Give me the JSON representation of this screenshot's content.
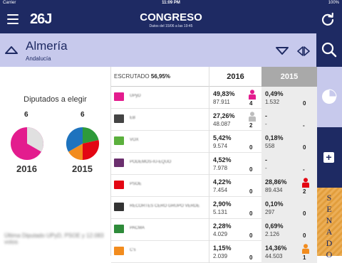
{
  "status": {
    "carrier": "Carrier",
    "time": "11:09 PM",
    "battery": "100%"
  },
  "nav": {
    "logo": "26J",
    "title": "CONGRESO",
    "subtitle": "Datos del 15/06 a las 19:45"
  },
  "region": {
    "name": "Almería",
    "sub": "Andalucía"
  },
  "left": {
    "title": "Diputados a elegir",
    "seats_2016": "6",
    "seats_2015": "6",
    "year_2016": "2016",
    "year_2015": "2015",
    "footer": "Última Diputado UPyD, PSOE y 12.083 votos"
  },
  "table": {
    "escrutado_label": "ESCRUTADO",
    "escrutado_value": "56,95%",
    "col_2016": "2016",
    "col_2015": "2015",
    "rows": [
      {
        "party": "UPyD",
        "color": "#e31c8e",
        "pct16": "49,83%",
        "votes16": "87.911",
        "seats16": "4",
        "pct15": "0,49%",
        "votes15": "1.532",
        "seats15": "0"
      },
      {
        "party": "EB",
        "color": "#444444",
        "pct16": "27,26%",
        "votes16": "48.087",
        "seats16": "2",
        "pct15": "-",
        "votes15": "-",
        "seats15": "-"
      },
      {
        "party": "VOX",
        "color": "#5bb03d",
        "pct16": "5,42%",
        "votes16": "9.574",
        "seats16": "0",
        "pct15": "0,18%",
        "votes15": "558",
        "seats15": "0"
      },
      {
        "party": "PODEMOS-IU-EQUO",
        "color": "#6b2f6e",
        "pct16": "4,52%",
        "votes16": "7.978",
        "seats16": "0",
        "pct15": "-",
        "votes15": "-",
        "seats15": "-"
      },
      {
        "party": "PSOE",
        "color": "#e30613",
        "pct16": "4,22%",
        "votes16": "7.454",
        "seats16": "0",
        "pct15": "28,86%",
        "votes15": "89.434",
        "seats15": "2"
      },
      {
        "party": "RECORTES CERO GRUPO VERDE",
        "color": "#333333",
        "pct16": "2,90%",
        "votes16": "5.131",
        "seats16": "0",
        "pct15": "0,10%",
        "votes15": "297",
        "seats15": "0"
      },
      {
        "party": "PACMA",
        "color": "#2e8b3a",
        "pct16": "2,28%",
        "votes16": "4.029",
        "seats16": "0",
        "pct15": "0,69%",
        "votes15": "2.126",
        "seats15": "0"
      },
      {
        "party": "C's",
        "color": "#f28c1e",
        "pct16": "1,15%",
        "votes16": "2.039",
        "seats16": "0",
        "pct15": "14,36%",
        "votes15": "44.503",
        "seats15": "1"
      }
    ]
  },
  "sidebar": {
    "senado": [
      "S",
      "E",
      "N",
      "A",
      "D",
      "O"
    ]
  },
  "colors": {
    "navy": "#1e2a63",
    "lavender": "#c7c9ec",
    "orange": "#e9a33f",
    "pp": "#1e73be",
    "psoe": "#e30613",
    "cs": "#f28c1e",
    "podemos": "#6b2f6e",
    "pacma": "#2e9a3a",
    "magenta": "#e31c8e"
  }
}
